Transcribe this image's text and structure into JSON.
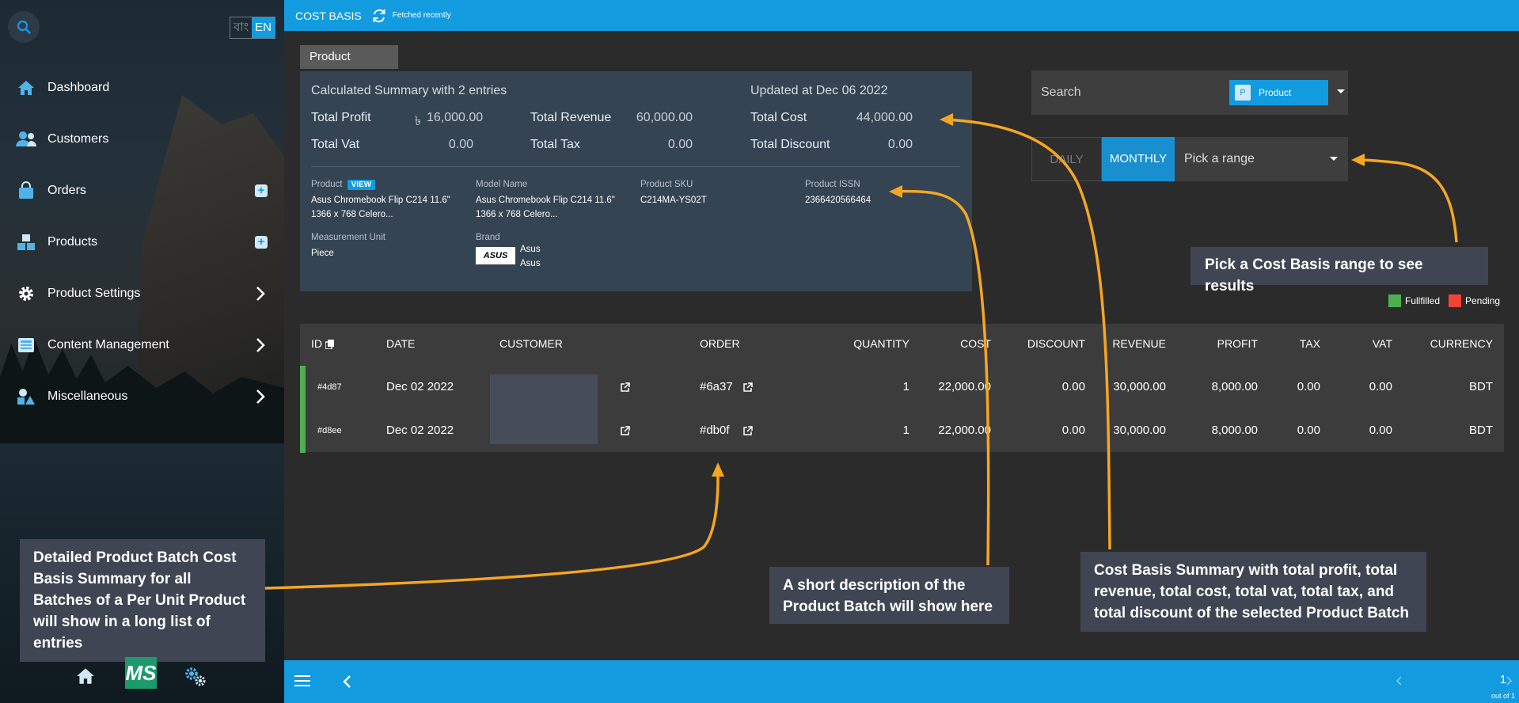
{
  "sidebar": {
    "lang_bn": "বাং",
    "lang_en": "EN",
    "items": [
      {
        "label": "Dashboard"
      },
      {
        "label": "Customers"
      },
      {
        "label": "Orders"
      },
      {
        "label": "Products"
      },
      {
        "label": "Product Settings"
      },
      {
        "label": "Content Management"
      },
      {
        "label": "Miscellaneous"
      }
    ],
    "logo_text": "MS"
  },
  "topbar": {
    "title": "COST BASIS",
    "status": "Fetched recently"
  },
  "tab": {
    "label": "Product"
  },
  "summary": {
    "heading": "Calculated Summary with 2 entries",
    "updated": "Updated at Dec 06 2022",
    "total_profit_label": "Total Profit",
    "total_profit_currency": "৳",
    "total_profit_value": "16,000.00",
    "total_revenue_label": "Total Revenue",
    "total_revenue_value": "60,000.00",
    "total_cost_label": "Total Cost",
    "total_cost_value": "44,000.00",
    "total_vat_label": "Total Vat",
    "total_vat_value": "0.00",
    "total_tax_label": "Total Tax",
    "total_tax_value": "0.00",
    "total_discount_label": "Total Discount",
    "total_discount_value": "0.00"
  },
  "product": {
    "product_label": "Product",
    "view_label": "VIEW",
    "product_name_1": "Asus Chromebook Flip C214 11.6\"",
    "product_name_2": "1366 x 768 Celero...",
    "model_label": "Model Name",
    "model_name_1": "Asus Chromebook Flip C214 11.6\"",
    "model_name_2": "1366 x 768 Celero...",
    "sku_label": "Product SKU",
    "sku": "C214MA-YS02T",
    "issn_label": "Product ISSN",
    "issn": "2366420566464",
    "unit_label": "Measurement Unit",
    "unit": "Piece",
    "brand_label": "Brand",
    "brand_1": "Asus",
    "brand_2": "Asus",
    "brand_logo_text": "ASUS"
  },
  "filters": {
    "search_label": "Search",
    "filter_avatar": "P",
    "filter_chip": "Product",
    "daily": "DAILY",
    "monthly": "MONTHLY",
    "range_placeholder": "Pick a range"
  },
  "legend": {
    "fulfilled": "Fullfilled",
    "pending": "Pending",
    "fulfilled_color": "#4caf50",
    "pending_color": "#f44336"
  },
  "table": {
    "headers": {
      "id": "ID",
      "date": "DATE",
      "customer": "CUSTOMER",
      "order": "ORDER",
      "quantity": "QUANTITY",
      "cost": "COST",
      "discount": "DISCOUNT",
      "revenue": "REVENUE",
      "profit": "PROFIT",
      "tax": "TAX",
      "vat": "VAT",
      "currency": "CURRENCY"
    },
    "rows": [
      {
        "id": "#4d87",
        "date": "Dec 02 2022",
        "order": "#6a37",
        "quantity": "1",
        "cost": "22,000.00",
        "discount": "0.00",
        "revenue": "30,000.00",
        "profit": "8,000.00",
        "tax": "0.00",
        "vat": "0.00",
        "currency": "BDT"
      },
      {
        "id": "#d8ee",
        "date": "Dec 02 2022",
        "order": "#db0f",
        "quantity": "1",
        "cost": "22,000.00",
        "discount": "0.00",
        "revenue": "30,000.00",
        "profit": "8,000.00",
        "tax": "0.00",
        "vat": "0.00",
        "currency": "BDT"
      }
    ]
  },
  "callouts": {
    "left": "Detailed Product Batch Cost Basis Summary for all Batches of a Per Unit Product will show in a long list of entries",
    "middle": "A short description of the Product Batch will show here",
    "right": "Cost Basis Summary with total profit, total revenue, total cost, total vat, total tax, and total discount of the selected Product Batch",
    "range": "Pick a Cost Basis range to see results"
  },
  "pagination": {
    "page": "1",
    "out_of": "out of 1"
  },
  "colors": {
    "accent": "#139be0",
    "callout_bg": "#3f4552",
    "arrow": "#f5a623"
  }
}
